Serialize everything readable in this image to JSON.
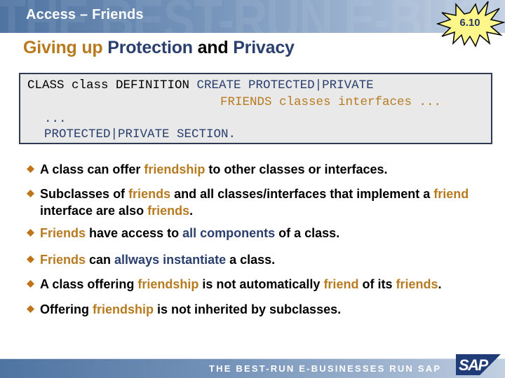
{
  "header": {
    "title": "Access – Friends",
    "watermark": "THE BEST-RUN E-BUSINESSES",
    "badge": "6.10"
  },
  "slide_title": {
    "part1": "Giving up ",
    "part2": "Protection",
    "part3": " and ",
    "part4": "Privacy"
  },
  "code": {
    "line1_a": "CLASS class DEFINITION ",
    "line1_b": "CREATE PROTECTED|PRIVATE",
    "line2": "FRIENDS classes interfaces ...",
    "line3": "...",
    "line4": "PROTECTED|PRIVATE SECTION."
  },
  "bullets": [
    {
      "segments": [
        {
          "text": "A class can offer ",
          "color": "black"
        },
        {
          "text": "friendship",
          "color": "orange"
        },
        {
          "text": " to other classes or interfaces.",
          "color": "black"
        }
      ]
    },
    {
      "segments": [
        {
          "text": "Subclasses of ",
          "color": "black"
        },
        {
          "text": "friends",
          "color": "orange"
        },
        {
          "text": " and all classes/interfaces that implement a ",
          "color": "black"
        },
        {
          "text": "friend",
          "color": "orange"
        },
        {
          "text": " interface are also ",
          "color": "black"
        },
        {
          "text": "friends",
          "color": "orange"
        },
        {
          "text": ".",
          "color": "black"
        }
      ]
    },
    {
      "segments": [
        {
          "text": "Friends",
          "color": "orange"
        },
        {
          "text": " have access to ",
          "color": "black"
        },
        {
          "text": "all components",
          "color": "navy"
        },
        {
          "text": " of a class.",
          "color": "black"
        }
      ]
    },
    {
      "segments": [
        {
          "text": "Friends",
          "color": "orange"
        },
        {
          "text": " can ",
          "color": "black"
        },
        {
          "text": "allways instantiate",
          "color": "navy"
        },
        {
          "text": " a class.",
          "color": "black"
        }
      ]
    },
    {
      "segments": [
        {
          "text": "A class offering ",
          "color": "black"
        },
        {
          "text": "friendship",
          "color": "orange"
        },
        {
          "text": " is not automatically ",
          "color": "black"
        },
        {
          "text": "friend",
          "color": "orange"
        },
        {
          "text": " of its ",
          "color": "black"
        },
        {
          "text": "friends",
          "color": "orange"
        },
        {
          "text": ".",
          "color": "black"
        }
      ]
    },
    {
      "segments": [
        {
          "text": "Offering ",
          "color": "black"
        },
        {
          "text": "friendship",
          "color": "orange"
        },
        {
          "text": " is not inherited by subclasses.",
          "color": "black"
        }
      ]
    }
  ],
  "bullet_icon": "diamond-icon",
  "footer": {
    "slogan": "THE BEST-RUN E-BUSINESSES RUN SAP",
    "logo": "SAP",
    "trademark": "™"
  },
  "colors": {
    "orange": "#b77a1f",
    "navy": "#2b3f6e",
    "black": "#000000",
    "bullet": "#c0741a",
    "badge_fill": "#fdf68a"
  }
}
